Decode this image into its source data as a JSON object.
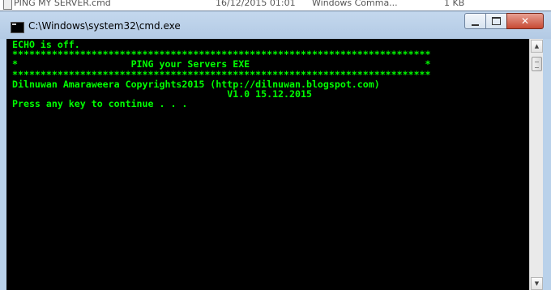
{
  "explorer": {
    "file_name": "PING MY SERVER.cmd",
    "date_modified": "16/12/2015 01:01",
    "type": "Windows Comma...",
    "size": "1 KB"
  },
  "window": {
    "title": "C:\\Windows\\system32\\cmd.exe",
    "minimize_label": "",
    "maximize_label": "",
    "close_label": "✕"
  },
  "console": {
    "lines": [
      "ECHO is off.",
      "**************************************************************************",
      "*                    PING your Servers EXE                               *",
      "**************************************************************************",
      "Dilnuwan Amaraweera Copyrights2015 (http://dilnuwan.blogspot.com)",
      "                                      V1.0 15.12.2015",
      "Press any key to continue . . ."
    ],
    "text_color": "#00ff00",
    "background_color": "#000000"
  },
  "scrollbar": {
    "up_arrow": "▲",
    "down_arrow": "▼"
  }
}
